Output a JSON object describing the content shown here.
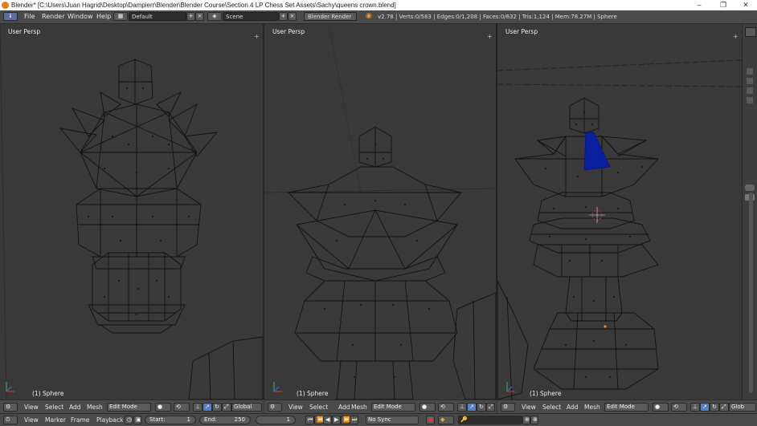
{
  "window": {
    "title": "Blender* [C:\\Users\\Juan Hagrid\\Desktop\\Dampierr\\Blender\\Blender Course\\Section 4 LP Chess Set Assets\\Sachy\\queens crown.blend]",
    "minimize": "–",
    "maximize": "❐",
    "close": "✕"
  },
  "topbar": {
    "menus": [
      "File",
      "Render",
      "Window",
      "Help"
    ],
    "screen_layout": "Default",
    "scene": "Scene",
    "render_engine": "Blender Render",
    "stats": "v2.78 | Verts:0/583 | Edges:0/1,208 | Faces:0/632 | Tris:1,124 | Mem:78.27M | Sphere"
  },
  "viewports": [
    {
      "label": "User Persp",
      "object": "(1) Sphere"
    },
    {
      "label": "User Persp",
      "object": "(1) Sphere"
    },
    {
      "label": "User Persp",
      "object": "(1) Sphere"
    }
  ],
  "header3d": {
    "menus": [
      "View",
      "Select",
      "Add",
      "Mesh"
    ],
    "mode": "Edit Mode",
    "orientation": "Global",
    "orientation_short": "Glob"
  },
  "timeline": {
    "menus": [
      "View",
      "Marker",
      "Frame",
      "Playback"
    ],
    "start": "Start:",
    "start_val": "1",
    "end": "End:",
    "end_val": "250",
    "current": "1",
    "sync": "No Sync"
  },
  "colors": {
    "selected_face": "#0a1fa0",
    "wire": "#111111",
    "viewport_bg": "#393939"
  }
}
